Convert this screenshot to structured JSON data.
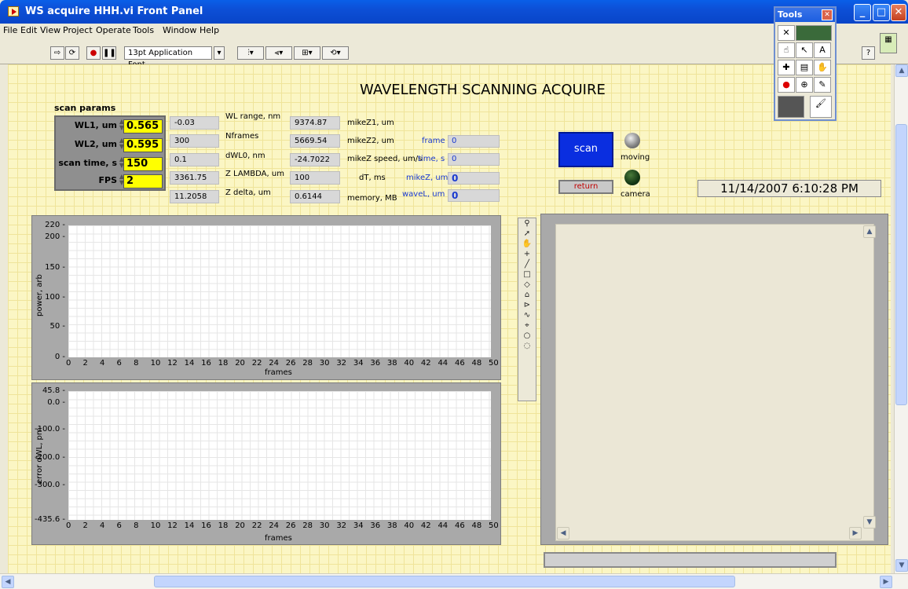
{
  "window": {
    "title": "WS acquire HHH.vi Front Panel"
  },
  "menu": [
    "File",
    "Edit",
    "View",
    "Project",
    "Operate",
    "Tools",
    "Window",
    "Help"
  ],
  "toolbar": {
    "font": "13pt Application Font"
  },
  "heading": "WAVELENGTH SCANNING ACQUIRE",
  "params": {
    "title": "scan params",
    "items": [
      {
        "label": "WL1, um",
        "value": "0.565"
      },
      {
        "label": "WL2, um",
        "value": "0.595"
      },
      {
        "label": "scan time, s",
        "value": "150"
      },
      {
        "label": "FPS",
        "value": "2"
      }
    ]
  },
  "col1": [
    {
      "value": "-0.03",
      "label": "WL range, nm"
    },
    {
      "value": "300",
      "label": "Nframes"
    },
    {
      "value": "0.1",
      "label": "dWL0, nm"
    },
    {
      "value": "3361.75",
      "label": "Z LAMBDA, um"
    },
    {
      "value": "11.2058",
      "label": "Z delta, um"
    }
  ],
  "col2": [
    {
      "value": "9374.87",
      "label": "mikeZ1, um"
    },
    {
      "value": "5669.54",
      "label": "mikeZ2, um"
    },
    {
      "value": "-24.7022",
      "label": "mikeZ speed, um/s"
    },
    {
      "value": "100",
      "label": "dT, ms"
    },
    {
      "value": "0.6144",
      "label": "memory, MB"
    }
  ],
  "col3": [
    {
      "label": "frame",
      "value": "0"
    },
    {
      "label": "time, s",
      "value": "0"
    },
    {
      "label": "mikeZ, um",
      "value": "0"
    },
    {
      "label": "waveL, um",
      "value": "0"
    }
  ],
  "buttons": {
    "scan": "scan",
    "return": "return"
  },
  "leds": {
    "moving": "moving",
    "camera": "camera"
  },
  "datetime": "11/14/2007 6:10:28 PM",
  "tools_palette": {
    "title": "Tools"
  },
  "graph1": {
    "ylabel": "power, arb",
    "xlabel": "frames",
    "yticks": [
      "220",
      "200",
      "150",
      "100",
      "50",
      "0"
    ],
    "xticks": [
      "0",
      "2",
      "4",
      "6",
      "8",
      "10",
      "12",
      "14",
      "16",
      "18",
      "20",
      "22",
      "24",
      "26",
      "28",
      "30",
      "32",
      "34",
      "36",
      "38",
      "40",
      "42",
      "44",
      "46",
      "48",
      "50"
    ]
  },
  "graph2": {
    "ylabel": "error dWL, pm",
    "xlabel": "frames",
    "yticks": [
      "45.8",
      "0.0",
      "-100.0",
      "-200.0",
      "-300.0",
      "-435.6"
    ],
    "xticks": [
      "0",
      "2",
      "4",
      "6",
      "8",
      "10",
      "12",
      "14",
      "16",
      "18",
      "20",
      "22",
      "24",
      "26",
      "28",
      "30",
      "32",
      "34",
      "36",
      "38",
      "40",
      "42",
      "44",
      "46",
      "48",
      "50"
    ]
  }
}
